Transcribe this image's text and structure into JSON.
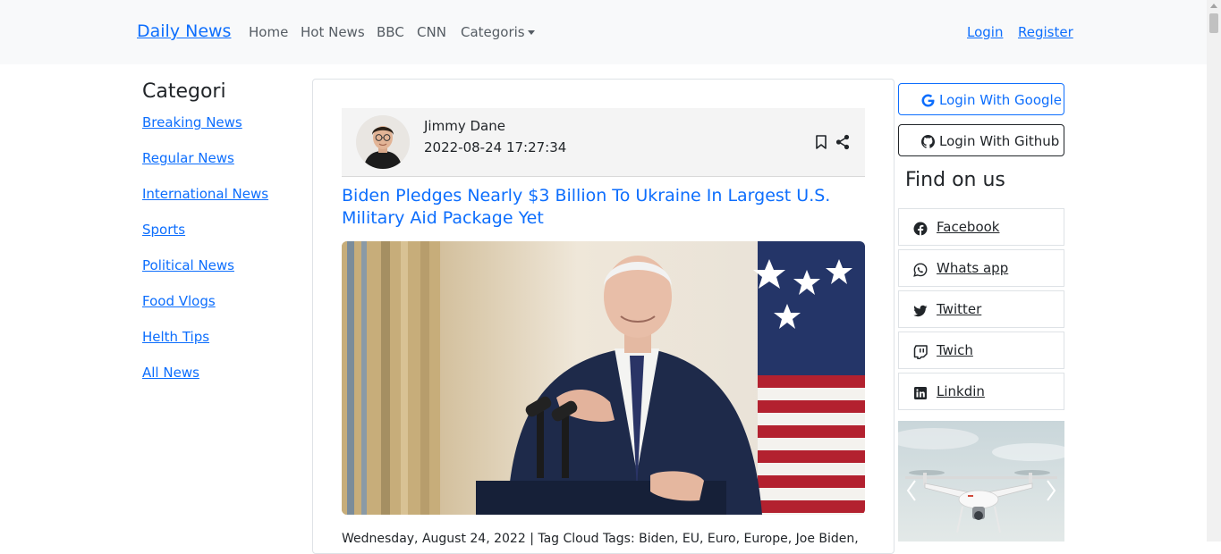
{
  "navbar": {
    "brand": "Daily News",
    "links": [
      "Home",
      "Hot News",
      "BBC",
      "CNN",
      "Categoris"
    ],
    "login": "Login",
    "register": "Register"
  },
  "sidebar": {
    "title": "Categori",
    "items": [
      "Breaking News",
      "Regular News",
      "International News",
      "Sports",
      "Political News",
      "Food Vlogs",
      "Helth Tips",
      "All News"
    ]
  },
  "post": {
    "author": "Jimmy Dane",
    "datetime": "2022-08-24 17:27:34",
    "headline": "Biden Pledges Nearly $3 Billion To Ukraine In Largest U.S. Military Aid Package Yet",
    "snippet": "Wednesday, August 24, 2022 | Tag Cloud Tags: Biden, EU, Euro, Europe, Joe Biden,"
  },
  "right": {
    "google": "Login With Google",
    "github": "Login With Github",
    "find_title": "Find on us",
    "socials": [
      "Facebook",
      "Whats app",
      "Twitter",
      "Twich",
      "Linkdin"
    ]
  },
  "colors": {
    "accent": "#0d6efd",
    "navbar_bg": "#f8f9fa",
    "text": "#212529"
  },
  "icons": [
    "google-icon",
    "github-icon",
    "facebook-icon",
    "whatsapp-icon",
    "twitter-icon",
    "twitch-icon",
    "linkedin-icon",
    "bookmark-icon",
    "share-icon"
  ]
}
